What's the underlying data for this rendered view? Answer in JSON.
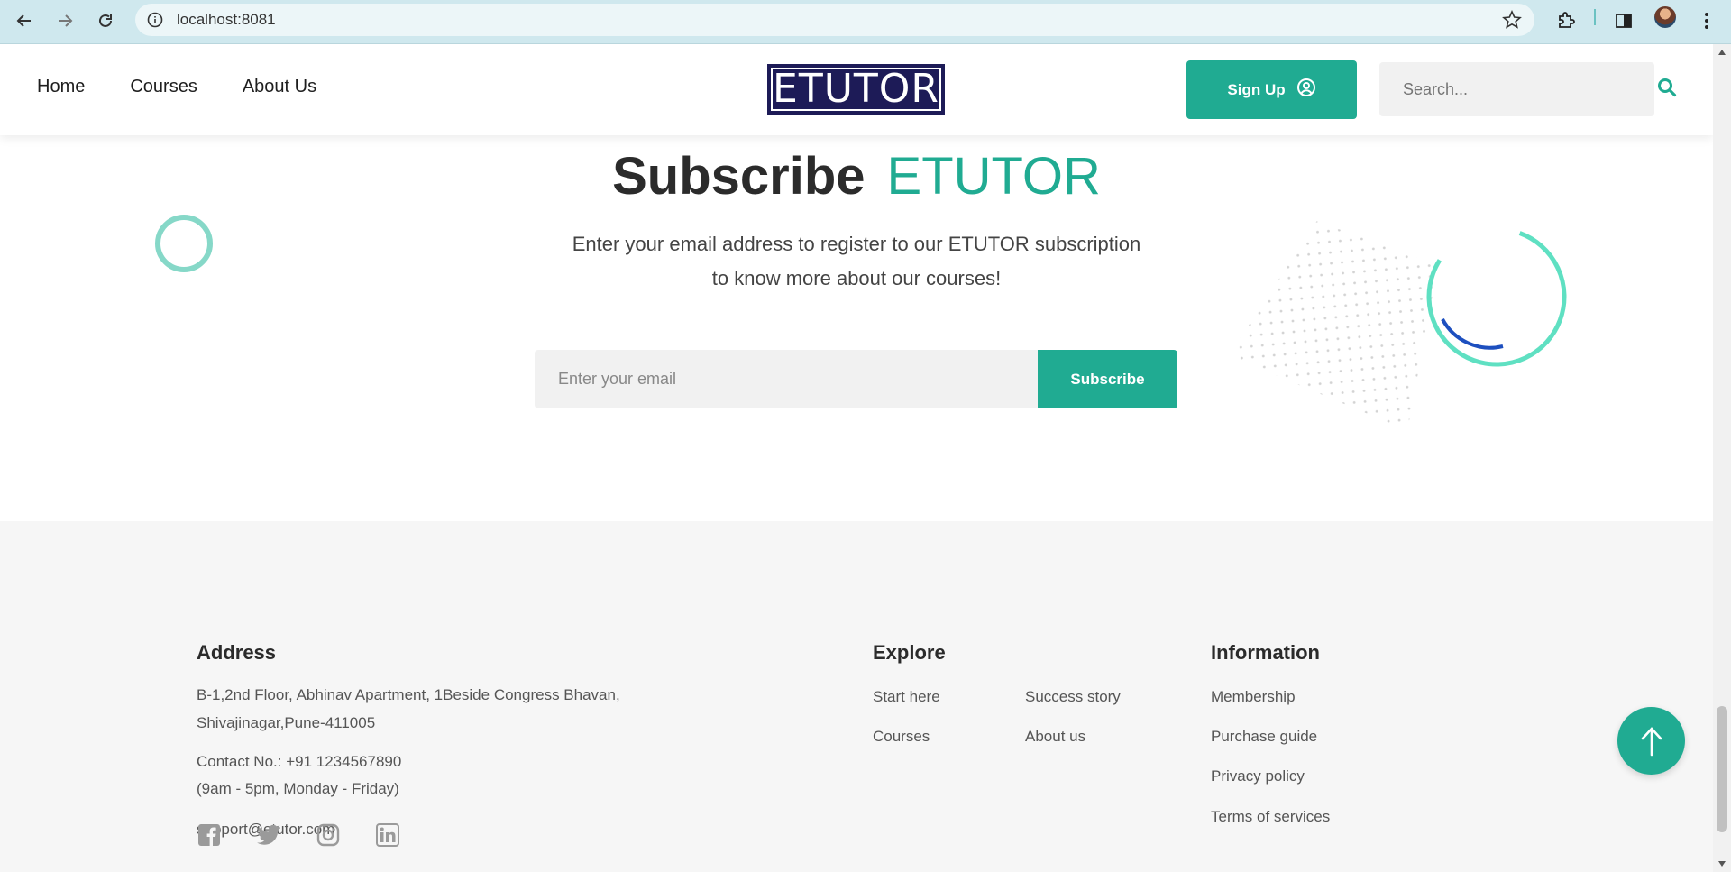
{
  "browser": {
    "url": "localhost:8081"
  },
  "header": {
    "nav": [
      "Home",
      "Courses",
      "About Us"
    ],
    "logo_text": "ETUTOR",
    "signup_label": "Sign Up",
    "search_placeholder": "Search..."
  },
  "subscribe": {
    "title": "Subscribe",
    "title_accent": "ETUTOR",
    "description_line1": "Enter your email address to register to our ETUTOR subscription",
    "description_line2": "to know more about our courses!",
    "email_placeholder": "Enter your email",
    "button_label": "Subscribe"
  },
  "footer": {
    "address_heading": "Address",
    "address_line1": "B-1,2nd Floor, Abhinav Apartment, 1Beside Congress Bhavan,",
    "address_line2": "Shivajinagar,Pune-411005",
    "contact_line": "Contact No.: +91 1234567890",
    "hours_line": "(9am - 5pm, Monday - Friday)",
    "email": "support@etutor.com",
    "explore_heading": "Explore",
    "explore_col1": [
      "Start here",
      "Courses"
    ],
    "explore_col2": [
      "Success story",
      "About us"
    ],
    "information_heading": "Information",
    "information_links": [
      "Membership",
      "Purchase guide",
      "Privacy policy",
      "Terms of services"
    ],
    "social_icons": [
      "facebook-icon",
      "twitter-icon",
      "instagram-icon",
      "linkedin-icon"
    ]
  },
  "colors": {
    "accent": "#20ab92",
    "logo_bg": "#1d1b57",
    "footer_bg": "#f6f6f6"
  }
}
